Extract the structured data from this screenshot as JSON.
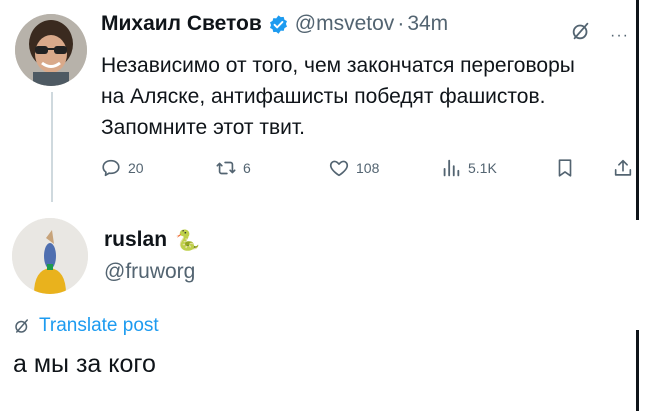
{
  "tweet": {
    "author_name": "Михаил Светов",
    "handle": "@msvetov",
    "separator": "·",
    "time": "34m",
    "text": "Независимо от того, чем закончатся переговоры на Аляске, антифашисты победят фашистов. Запомните этот твит.",
    "stats": {
      "replies": "20",
      "reposts": "6",
      "likes": "108",
      "views": "5.1K"
    },
    "icons": {
      "verified": "verified-badge-icon",
      "grok": "grok-icon",
      "more": "more-icon",
      "reply": "reply-icon",
      "repost": "repost-icon",
      "like": "like-icon",
      "views": "views-icon",
      "bookmark": "bookmark-icon",
      "share": "share-icon"
    },
    "more_glyph": "···",
    "colors": {
      "verified": "#1d9bf0",
      "muted": "#536471"
    }
  },
  "reply": {
    "author_name": "ruslan",
    "handle": "@fruworg",
    "emoji": "🐍",
    "translate_label": "Translate post",
    "text": "а мы за кого",
    "colors": {
      "link": "#1d9bf0"
    }
  }
}
